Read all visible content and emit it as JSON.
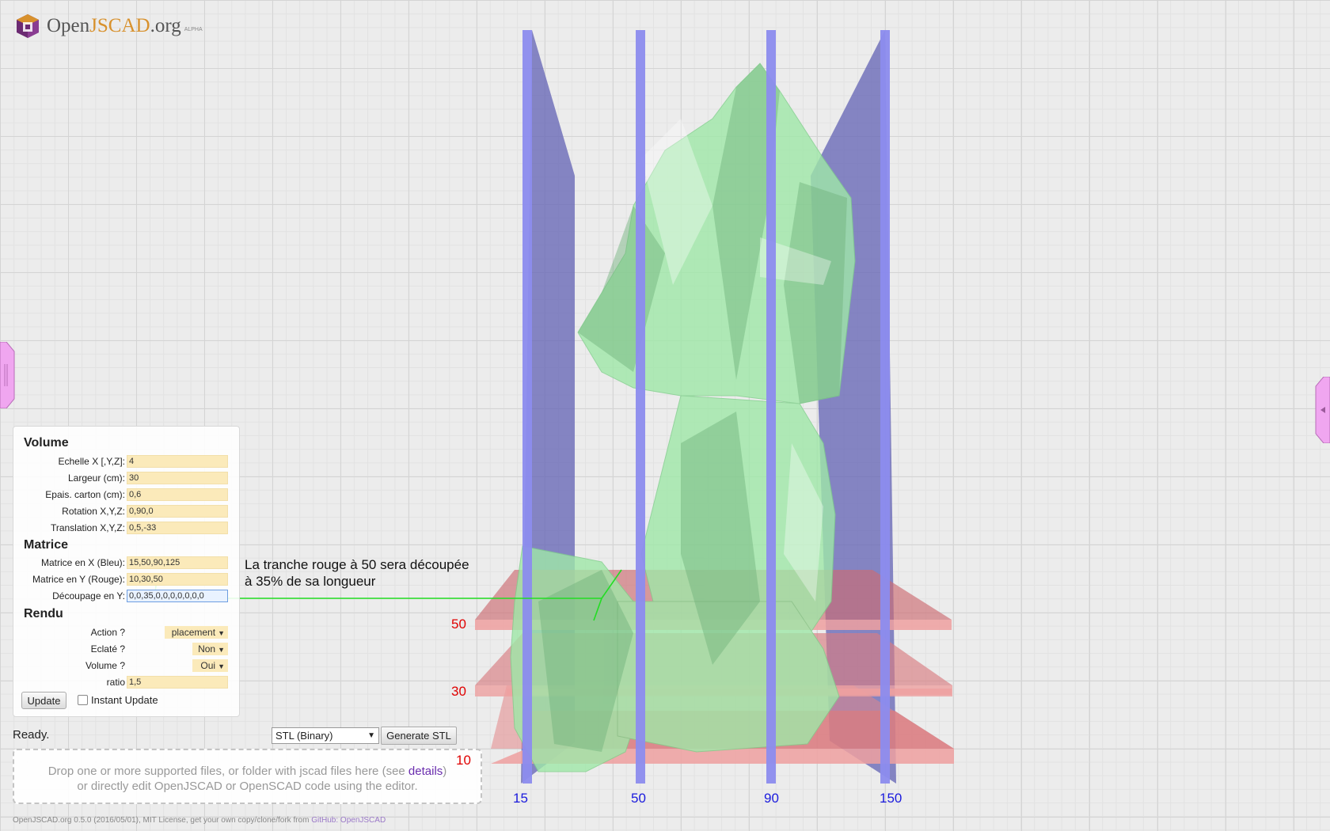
{
  "app": {
    "title_prefix": "Open",
    "title_highlight": "JSCAD",
    "title_suffix": ".org",
    "badge": "ALPHA",
    "logo_icon": "openjscad-cube-logo"
  },
  "params": {
    "volume": {
      "heading": "Volume",
      "fields": [
        {
          "label": "Echelle X [,Y,Z]:",
          "value": "4"
        },
        {
          "label": "Largeur (cm):",
          "value": "30"
        },
        {
          "label": "Epais. carton (cm):",
          "value": "0,6"
        },
        {
          "label": "Rotation X,Y,Z:",
          "value": "0,90,0"
        },
        {
          "label": "Translation X,Y,Z:",
          "value": "0,5,-33"
        }
      ]
    },
    "matrice": {
      "heading": "Matrice",
      "fields": [
        {
          "label": "Matrice en X (Bleu):",
          "value": "15,50,90,125"
        },
        {
          "label": "Matrice en Y (Rouge):",
          "value": "10,30,50"
        },
        {
          "label": "Découpage en Y:",
          "value": "0,0,35,0,0,0,0,0,0,0"
        }
      ]
    },
    "rendu": {
      "heading": "Rendu",
      "action": {
        "label": "Action ?",
        "value": "placement"
      },
      "eclate": {
        "label": "Eclaté ?",
        "value": "Non"
      },
      "volume": {
        "label": "Volume ?",
        "value": "Oui"
      },
      "ratio": {
        "label": "ratio",
        "value": "1,5"
      }
    },
    "update_button": "Update",
    "instant_update_label": "Instant Update",
    "instant_update_checked": false
  },
  "status": "Ready.",
  "export": {
    "format_selected": "STL (Binary)",
    "generate_button": "Generate STL"
  },
  "dropzone": {
    "line1_prefix": "Drop one or more supported files, or folder with jscad files here (see ",
    "link": "details",
    "line1_suffix": ")",
    "line2": "or directly edit OpenJSCAD or OpenSCAD code using the editor."
  },
  "footer": {
    "text": "OpenJSCAD.org 0.5.0 (2016/05/01), MIT License, get your own copy/clone/fork from ",
    "link": "GitHub: OpenJSCAD"
  },
  "annotation": {
    "line1": "La tranche rouge à 50 sera découpée",
    "line2": "à 35% de sa longueur",
    "color": "#22dd22"
  },
  "viewer": {
    "red_slice_labels": [
      "50",
      "30",
      "10"
    ],
    "blue_slice_labels": [
      "15",
      "50",
      "90",
      "150"
    ],
    "colors": {
      "red_slice": "#f08a8a",
      "blue_slice": "#8c8cee",
      "model": "#9fe8a8",
      "red_label": "#e00000",
      "blue_label": "#1a1add",
      "panel_tab": "#f0a6f0"
    }
  }
}
